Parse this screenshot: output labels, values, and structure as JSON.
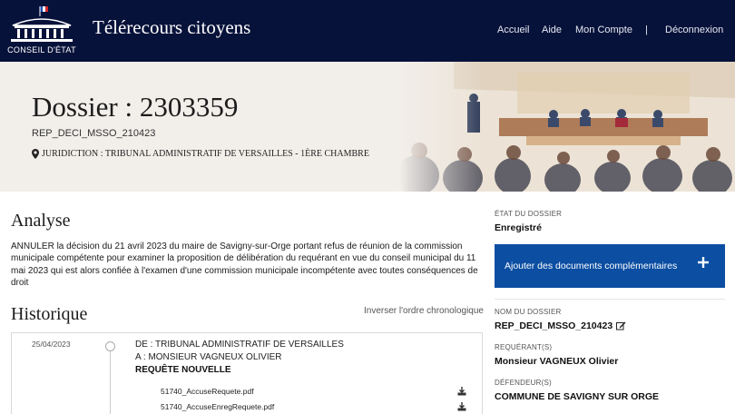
{
  "header": {
    "logo_text": "CONSEIL D'ÉTAT",
    "app_title": "Télérecours citoyens",
    "nav": {
      "accueil": "Accueil",
      "aide": "Aide",
      "mon_compte": "Mon Compte",
      "separator": "|",
      "deconnexion": "Déconnexion"
    }
  },
  "banner": {
    "title": "Dossier : 2303359",
    "reference": "REP_DECI_MSSO_210423",
    "juridiction": "JURIDICTION : TRIBUNAL ADMINISTRATIF DE VERSAILLES - 1ÈRE CHAMBRE"
  },
  "analyse": {
    "title": "Analyse",
    "text": "ANNULER la décision du 21 avril 2023 du maire de Savigny-sur-Orge portant refus de réunion de la commission municipale compétente pour examiner la proposition de délibération du requérant en vue du conseil municipal du 11 mai 2023 qui est alors confiée à l'examen d'une commission municipale incompétente avec toutes conséquences de droit"
  },
  "historique": {
    "title": "Historique",
    "inverser_label": "Inverser l'ordre chronologique",
    "entries": [
      {
        "date": "25/04/2023",
        "de": "DE : TRIBUNAL ADMINISTRATIF DE VERSAILLES",
        "a": "A : MONSIEUR VAGNEUX OLIVIER",
        "type": "REQUÊTE NOUVELLE",
        "files": [
          "51740_AccuseRequete.pdf",
          "51740_AccuseEnregRequete.pdf"
        ]
      }
    ]
  },
  "sidebar": {
    "etat_label": "ÉTAT DU DOSSIER",
    "etat_value": "Enregistré",
    "add_button_label": "Ajouter des documents complémentaires",
    "nom_label": "NOM DU DOSSIER",
    "nom_value": "REP_DECI_MSSO_210423",
    "requerant_label": "REQUÉRANT(S)",
    "requerant_value": "Monsieur VAGNEUX Olivier",
    "defendeur_label": "DÉFENDEUR(S)",
    "defendeur_value": "COMMUNE DE SAVIGNY SUR ORGE"
  },
  "colors": {
    "header_bg": "#07123a",
    "banner_bg": "#f2eeea",
    "primary_button": "#0b4ea2"
  },
  "icons": {
    "logo": "conseil-etat-building-icon",
    "location": "map-marker-icon",
    "download": "download-icon",
    "edit": "edit-icon",
    "add": "plus-icon"
  }
}
